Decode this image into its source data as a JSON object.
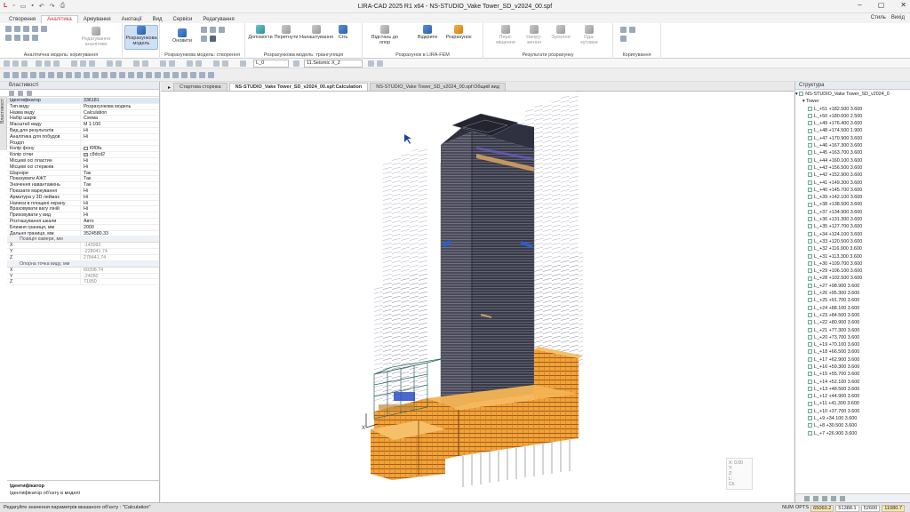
{
  "window": {
    "title": "LIRA-CAD 2025 R1 x64 - NS-STUDIO_Vake Tower_SD_v2024_00.spf"
  },
  "menu_tabs": [
    "Створення",
    "Аналітика",
    "Армування",
    "Анотації",
    "Вид",
    "Сервіси",
    "Редагування"
  ],
  "active_tab": "Аналітика",
  "tabs_right": [
    "Стиль",
    "Вихід"
  ],
  "ribbon": {
    "groups": [
      {
        "label": "Аналітична модель: коригування",
        "buttons": [
          "Редагування аналітики"
        ]
      },
      {
        "label": "Розрахункова модель",
        "buttons": [
          "Розрахункова модель"
        ]
      },
      {
        "label": "Розрахункова модель: створення",
        "buttons": [
          "Оновити"
        ]
      },
      {
        "label": "Розрахункова модель: тріангуляція",
        "buttons": [
          "Допомогти",
          "Перетнути",
          "Налаштування",
          "Сіть"
        ]
      },
      {
        "label": "Розрахунок в LIRA-FEM",
        "buttons": [
          "Відстань до опор",
          "Відкрити",
          "Розрахунок"
        ]
      },
      {
        "label": "Результати розрахунку",
        "buttons": [
          "Пере-міщення",
          "Напру-ження",
          "Зусилля",
          "Ода-кутовки"
        ]
      },
      {
        "label": "Коригування",
        "buttons": []
      }
    ]
  },
  "toolbar": {
    "layer_value": "L_0",
    "load_case_value": "11.Seismic X_2"
  },
  "left_panel": {
    "title": "Властивості",
    "side_tab": "Властивості",
    "props": [
      {
        "k": "Ідентифікатор",
        "v": "336181",
        "sel": true
      },
      {
        "k": "Тип виду",
        "v": "Розрахункова модель"
      },
      {
        "k": "Назва виду",
        "v": "Calculation"
      },
      {
        "k": "Набір шарів",
        "v": "Схема"
      },
      {
        "k": "Масштаб виду",
        "v": "М 1:100"
      },
      {
        "k": "Вид для результатів",
        "v": "Ні"
      },
      {
        "k": "Аналітика для побудов",
        "v": "Ні"
      },
      {
        "k": "Розділ",
        "v": ""
      },
      {
        "k": "Колір фону",
        "v": "f0f0fa",
        "swatch": "#f0f0fa"
      },
      {
        "k": "Колір сітки",
        "v": "c8dcd2",
        "swatch": "#c8dcd2"
      },
      {
        "k": "Місцеві осі пластин",
        "v": "Ні"
      },
      {
        "k": "Місцеві осі стержнів",
        "v": "Ні"
      },
      {
        "k": "Шарніри",
        "v": "Так"
      },
      {
        "k": "Показувати АЖТ",
        "v": "Так"
      },
      {
        "k": "Значення навантажень",
        "v": "Так"
      },
      {
        "k": "Показати маркування",
        "v": "Ні"
      },
      {
        "k": "Арматура у 3D леймах",
        "v": "Ні"
      },
      {
        "k": "Написи в площині екрану",
        "v": "Ні"
      },
      {
        "k": "Враховувати вагу ліній",
        "v": "Ні"
      },
      {
        "k": "Приховувати у вид",
        "v": "Ні"
      },
      {
        "k": "Розташування шкали",
        "v": "Авто"
      },
      {
        "k": "Ближня границя, мм",
        "v": "2000"
      },
      {
        "k": "Дальня границя, мм",
        "v": "3524580.33"
      }
    ],
    "camera_group": "Позиція камери, мм",
    "camera": [
      {
        "k": "X",
        "v": "-143092"
      },
      {
        "k": "Y",
        "v": "-228041.74"
      },
      {
        "k": "Z",
        "v": "278441.74"
      }
    ],
    "target_group": "Опорна точка виду, мм",
    "target": [
      {
        "k": "X",
        "v": "60398.74"
      },
      {
        "k": "Y",
        "v": "-24050"
      },
      {
        "k": "Z",
        "v": "71950"
      }
    ],
    "desc_title": "Ідентифікатор",
    "desc_text": "Ідентифікатор об'єкту в моделі"
  },
  "doc_tabs": [
    {
      "label": "Стартова сторінка",
      "active": false
    },
    {
      "label": "NS-STUDIO_Vake Tower_SD_v2024_00.spf:Calculation",
      "active": true
    },
    {
      "label": "NS-STUDIO_Vake Tower_SD_v2024_00.spf:Общий вид",
      "active": false
    }
  ],
  "viewport": {
    "axes": [
      "X",
      "Y",
      "Z"
    ],
    "coords_box": [
      "X: 0.00",
      "Y:",
      "Z:",
      "L:",
      "Ch"
    ]
  },
  "right_panel": {
    "title": "Структура",
    "root": "NS-STUDIO_Vake Tower_SD_v2024_0",
    "group": "Tower",
    "levels": [
      "L_+51 +182.500 3.600",
      "L_+50 +180.000 2.500",
      "L_+49 +176.400 3.600",
      "L_+48 +174.500 1.900",
      "L_+47 +170.900 3.600",
      "L_+46 +167.300 3.600",
      "L_+45 +163.700 3.600",
      "L_+44 +160.100 3.600",
      "L_+43 +156.500 3.600",
      "L_+42 +152.900 3.600",
      "L_+41 +149.300 3.600",
      "L_+40 +145.700 3.600",
      "L_+39 +142.100 3.600",
      "L_+38 +138.500 3.600",
      "L_+37 +134.900 3.600",
      "L_+36 +131.300 3.600",
      "L_+35 +127.700 3.600",
      "L_+34 +124.100 3.600",
      "L_+33 +120.500 3.600",
      "L_+32 +116.900 3.600",
      "L_+31 +113.300 3.600",
      "L_+30 +109.700 3.600",
      "L_+29 +106.100 3.600",
      "L_+28 +102.500 3.600",
      "L_+27 +98.900 3.600",
      "L_+26 +95.300 3.600",
      "L_+25 +91.700 3.600",
      "L_+24 +88.100 3.600",
      "L_+23 +84.500 3.600",
      "L_+22 +80.900 3.600",
      "L_+21 +77.300 3.600",
      "L_+20 +73.700 3.600",
      "L_+19 +70.100 3.600",
      "L_+18 +66.500 3.600",
      "L_+17 +62.900 3.600",
      "L_+16 +59.300 3.600",
      "L_+15 +55.700 3.600",
      "L_+14 +52.100 3.600",
      "L_+13 +48.500 3.600",
      "L_+12 +44.900 3.600",
      "L_+11 +41.300 3.600",
      "L_+10 +37.700 3.600",
      "L_+9 +34.100 3.600",
      "L_+8 +30.500 3.600",
      "L_+7 +26.900 3.600"
    ]
  },
  "status": {
    "text": "Редагуйте значення параметрів вказаного об'єкту : \"Calculation\"",
    "num": "NUM",
    "opts": "OPTS",
    "x": "65060.2",
    "y": "51388.1",
    "z": "52600",
    "zoom": "11080.7"
  }
}
